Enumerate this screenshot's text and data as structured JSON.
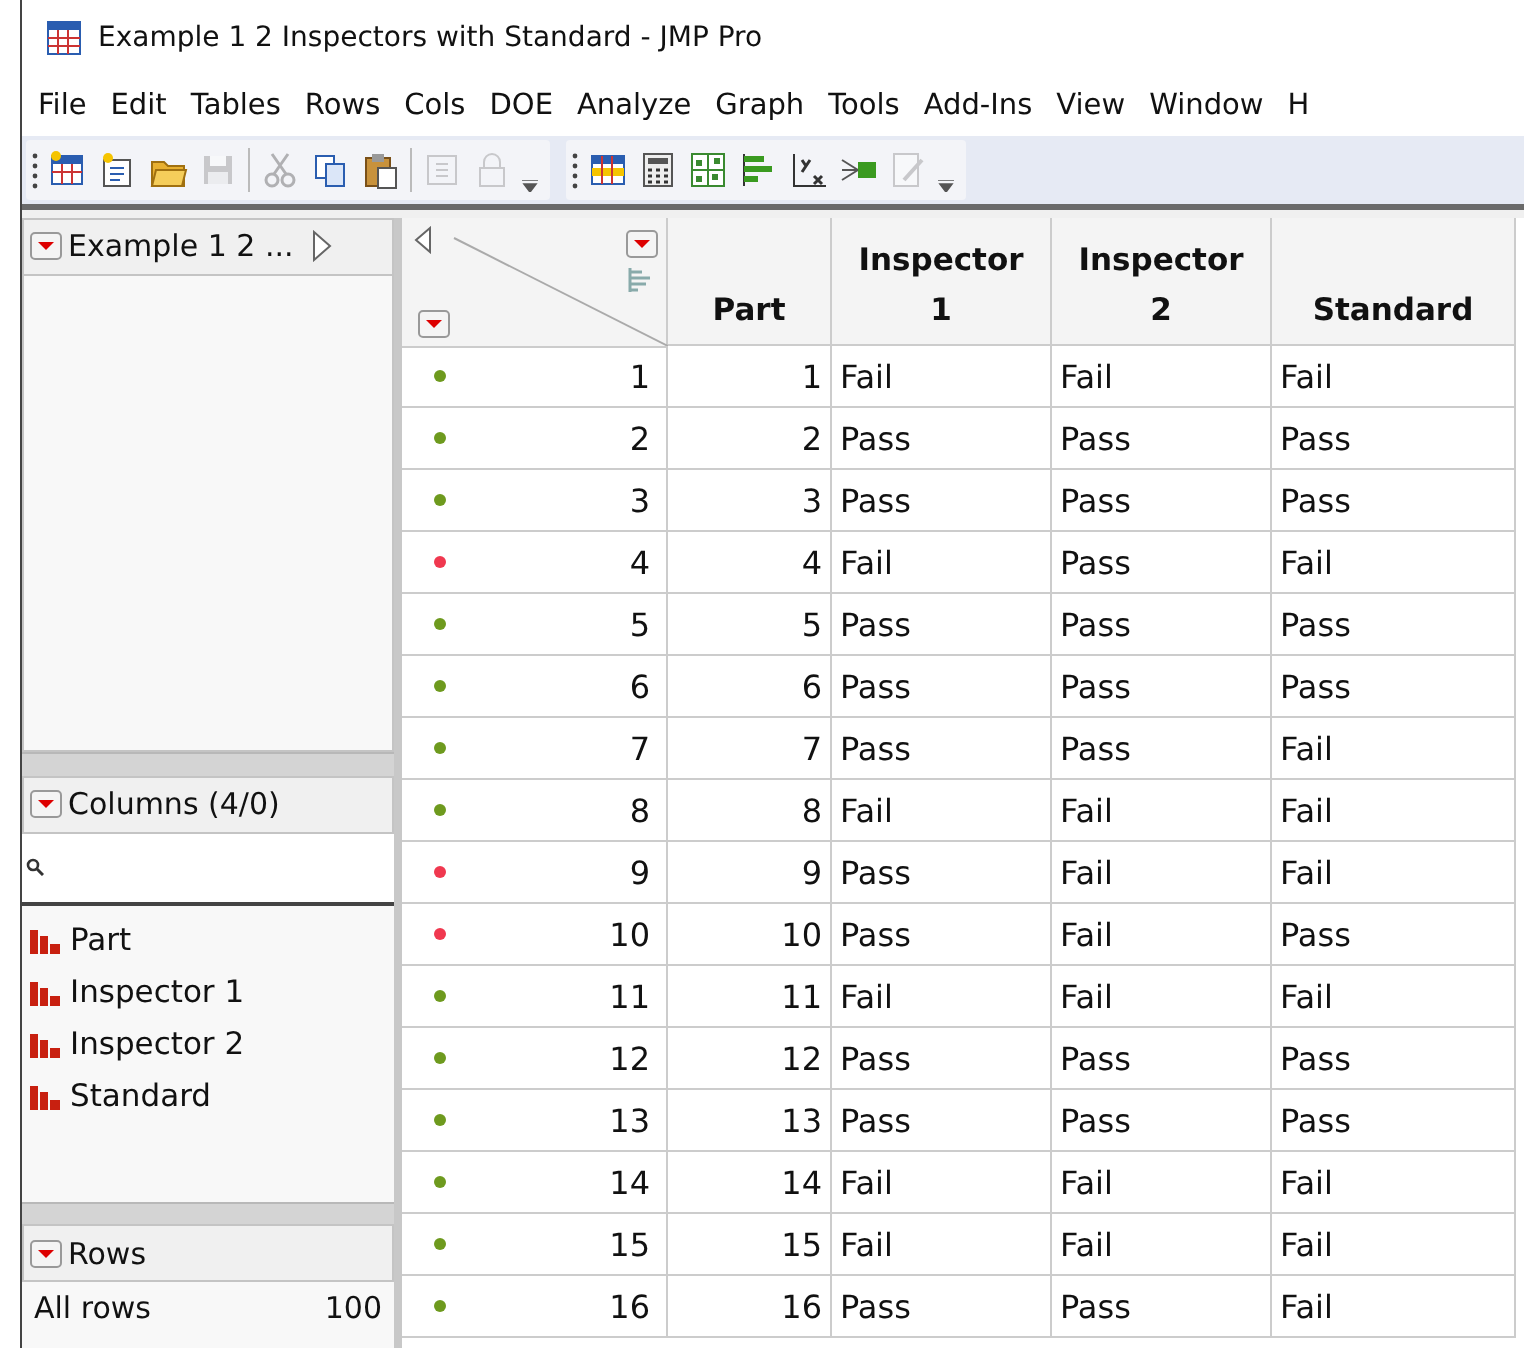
{
  "window": {
    "title": "Example 1  2 Inspectors with Standard - JMP Pro"
  },
  "menu": [
    "File",
    "Edit",
    "Tables",
    "Rows",
    "Cols",
    "DOE",
    "Analyze",
    "Graph",
    "Tools",
    "Add-Ins",
    "View",
    "Window",
    "H"
  ],
  "toolbars": [
    {
      "items": [
        {
          "kind": "newtable",
          "disabled": false
        },
        {
          "kind": "script",
          "disabled": false
        },
        {
          "kind": "open",
          "disabled": false
        },
        {
          "kind": "save",
          "disabled": true
        },
        {
          "kind": "sep"
        },
        {
          "kind": "cut",
          "disabled": true
        },
        {
          "kind": "copy",
          "disabled": false
        },
        {
          "kind": "paste",
          "disabled": false
        },
        {
          "kind": "sep"
        },
        {
          "kind": "colinfo",
          "disabled": true
        },
        {
          "kind": "lock",
          "disabled": true
        }
      ]
    },
    {
      "items": [
        {
          "kind": "table",
          "disabled": false
        },
        {
          "kind": "calc",
          "disabled": false
        },
        {
          "kind": "grid",
          "disabled": false
        },
        {
          "kind": "bars",
          "disabled": false
        },
        {
          "kind": "fit",
          "disabled": false
        },
        {
          "kind": "flow",
          "disabled": false
        },
        {
          "kind": "edit",
          "disabled": true
        }
      ]
    }
  ],
  "table_panel": {
    "title": "Example 1  2 ..."
  },
  "columns_panel": {
    "title": "Columns (4/0)",
    "columns": [
      "Part",
      "Inspector 1",
      "Inspector 2",
      "Standard"
    ]
  },
  "rows_panel": {
    "title": "Rows",
    "items": [
      {
        "label": "All rows",
        "count": "100"
      }
    ]
  },
  "table": {
    "columns": [
      "Part",
      "Inspector\n1",
      "Inspector\n2",
      "Standard"
    ],
    "rows": [
      {
        "num": "1",
        "color": "#6e9a1e",
        "cells": [
          "1",
          "Fail",
          "Fail",
          "Fail"
        ]
      },
      {
        "num": "2",
        "color": "#6e9a1e",
        "cells": [
          "2",
          "Pass",
          "Pass",
          "Pass"
        ]
      },
      {
        "num": "3",
        "color": "#6e9a1e",
        "cells": [
          "3",
          "Pass",
          "Pass",
          "Pass"
        ]
      },
      {
        "num": "4",
        "color": "#f0384f",
        "cells": [
          "4",
          "Fail",
          "Pass",
          "Fail"
        ]
      },
      {
        "num": "5",
        "color": "#6e9a1e",
        "cells": [
          "5",
          "Pass",
          "Pass",
          "Pass"
        ]
      },
      {
        "num": "6",
        "color": "#6e9a1e",
        "cells": [
          "6",
          "Pass",
          "Pass",
          "Pass"
        ]
      },
      {
        "num": "7",
        "color": "#6e9a1e",
        "cells": [
          "7",
          "Pass",
          "Pass",
          "Fail"
        ]
      },
      {
        "num": "8",
        "color": "#6e9a1e",
        "cells": [
          "8",
          "Fail",
          "Fail",
          "Fail"
        ]
      },
      {
        "num": "9",
        "color": "#f0384f",
        "cells": [
          "9",
          "Pass",
          "Fail",
          "Fail"
        ]
      },
      {
        "num": "10",
        "color": "#f0384f",
        "cells": [
          "10",
          "Pass",
          "Fail",
          "Pass"
        ]
      },
      {
        "num": "11",
        "color": "#6e9a1e",
        "cells": [
          "11",
          "Fail",
          "Fail",
          "Fail"
        ]
      },
      {
        "num": "12",
        "color": "#6e9a1e",
        "cells": [
          "12",
          "Pass",
          "Pass",
          "Pass"
        ]
      },
      {
        "num": "13",
        "color": "#6e9a1e",
        "cells": [
          "13",
          "Pass",
          "Pass",
          "Pass"
        ]
      },
      {
        "num": "14",
        "color": "#6e9a1e",
        "cells": [
          "14",
          "Fail",
          "Fail",
          "Fail"
        ]
      },
      {
        "num": "15",
        "color": "#6e9a1e",
        "cells": [
          "15",
          "Fail",
          "Fail",
          "Fail"
        ]
      },
      {
        "num": "16",
        "color": "#6e9a1e",
        "cells": [
          "16",
          "Pass",
          "Pass",
          "Fail"
        ]
      }
    ]
  }
}
